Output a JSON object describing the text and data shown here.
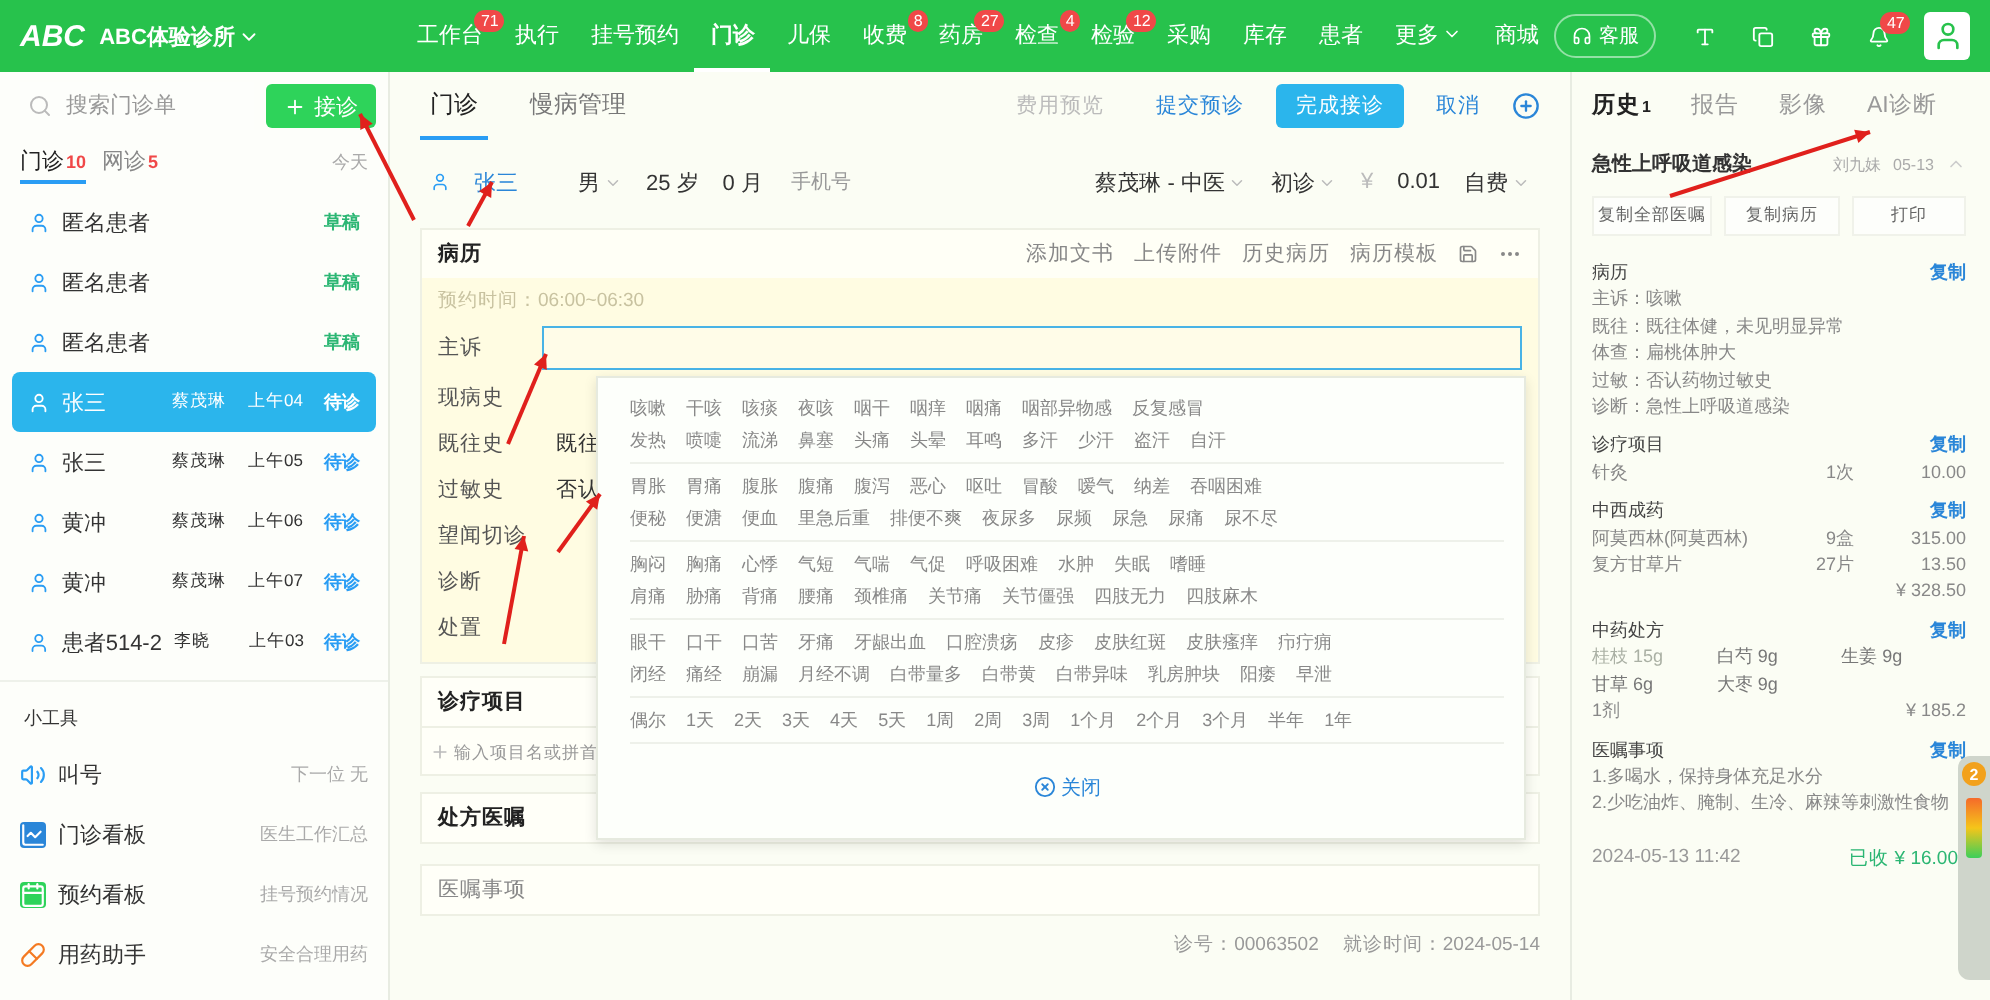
{
  "top_bar": {
    "logo": "ABC",
    "clinic": "ABC体验诊所",
    "nav": [
      {
        "label": "工作台",
        "badge": "71",
        "selected": false
      },
      {
        "label": "执行",
        "selected": false
      },
      {
        "label": "挂号预约",
        "selected": false
      },
      {
        "label": "门诊",
        "selected": true
      },
      {
        "label": "儿保",
        "selected": false
      },
      {
        "label": "收费",
        "badge": "8",
        "selected": false
      },
      {
        "label": "药房",
        "badge": "27",
        "selected": false
      },
      {
        "label": "检查",
        "badge": "4",
        "selected": false
      },
      {
        "label": "检验",
        "badge": "12",
        "selected": false
      },
      {
        "label": "采购",
        "selected": false
      },
      {
        "label": "库存",
        "selected": false
      },
      {
        "label": "患者",
        "selected": false
      },
      {
        "label": "更多",
        "selected": false,
        "caret": true
      },
      {
        "label": "商城",
        "selected": false
      }
    ],
    "service": "客服",
    "notification_badge": "47"
  },
  "left_panel": {
    "search": {
      "placeholder": "搜索门诊单"
    },
    "new_button": "接诊",
    "tabs": [
      {
        "label": "门诊",
        "count": "10",
        "selected": true
      },
      {
        "label": "网诊",
        "count": "5",
        "selected": false
      }
    ],
    "date_filter": "今天",
    "patients": [
      {
        "name": "匿名患者",
        "status": "草稿",
        "color": "#2bb673",
        "selected": false
      },
      {
        "name": "匿名患者",
        "status": "草稿",
        "color": "#2bb673",
        "selected": false
      },
      {
        "name": "匿名患者",
        "status": "草稿",
        "color": "#2bb673",
        "selected": false
      },
      {
        "name": "张三",
        "doctor": "蔡茂琳",
        "time": "上午04",
        "status": "待诊",
        "selected": true
      },
      {
        "name": "张三",
        "doctor": "蔡茂琳",
        "time": "上午05",
        "status": "待诊",
        "color": "#2a9df4",
        "selected": false
      },
      {
        "name": "黄冲",
        "doctor": "蔡茂琳",
        "time": "上午06",
        "status": "待诊",
        "color": "#2a9df4",
        "selected": false
      },
      {
        "name": "黄冲",
        "doctor": "蔡茂琳",
        "time": "上午07",
        "status": "待诊",
        "color": "#2a9df4",
        "selected": false
      },
      {
        "name": "患者514-2",
        "doctor": "李晓",
        "time": "上午03",
        "status": "待诊",
        "color": "#2a9df4",
        "selected": false
      }
    ],
    "tools_title": "小工具",
    "tools": [
      {
        "kind": "speaker",
        "label": "叫号",
        "hint": "下一位 无"
      },
      {
        "kind": "chart",
        "label": "门诊看板",
        "hint": "医生工作汇总"
      },
      {
        "kind": "calendar",
        "label": "预约看板",
        "hint": "挂号预约情况"
      },
      {
        "kind": "pill",
        "label": "用药助手",
        "hint": "安全合理用药"
      }
    ]
  },
  "main": {
    "tabs": [
      {
        "label": "门诊",
        "selected": true
      },
      {
        "label": "慢病管理",
        "selected": false
      }
    ],
    "actions": [
      {
        "label": "费用预览",
        "kind": "disabled"
      },
      {
        "label": "提交预诊",
        "kind": "link"
      },
      {
        "label": "完成接诊",
        "kind": "primary"
      },
      {
        "label": "取消",
        "kind": "link"
      }
    ],
    "patient": {
      "name": "张三",
      "sex": "男",
      "age_years": "25 岁",
      "age_months": "0 月",
      "phone": {
        "placeholder": "手机号"
      },
      "doctor": "蔡茂琳 - 中医",
      "visit_type": "初诊",
      "currency": "¥",
      "fee": "0.01",
      "payment": "自费"
    },
    "record": {
      "title": "病历",
      "tools": [
        "添加文书",
        "上传附件",
        "历史病历",
        "病历模板"
      ],
      "appointment": "预约时间：06:00~06:30",
      "fields": [
        {
          "label": "主诉",
          "focused": true
        },
        {
          "label": "现病史",
          "focused": false
        },
        {
          "label": "既往史",
          "value": "既往",
          "focused": false
        },
        {
          "label": "过敏史",
          "value": "否认",
          "focused": false
        },
        {
          "label": "望闻切诊",
          "focused": false
        },
        {
          "label": "诊断",
          "focused": false
        },
        {
          "label": "处置",
          "focused": false
        }
      ]
    },
    "suggestions": {
      "groups": [
        [
          [
            "咳嗽",
            "干咳",
            "咳痰",
            "夜咳",
            "咽干",
            "咽痒",
            "咽痛",
            "咽部异物感",
            "反复感冒"
          ],
          [
            "发热",
            "喷嚏",
            "流涕",
            "鼻塞",
            "头痛",
            "头晕",
            "耳鸣",
            "多汗",
            "少汗",
            "盗汗",
            "自汗"
          ]
        ],
        [
          [
            "胃胀",
            "胃痛",
            "腹胀",
            "腹痛",
            "腹泻",
            "恶心",
            "呕吐",
            "冒酸",
            "嗳气",
            "纳差",
            "吞咽困难"
          ],
          [
            "便秘",
            "便溏",
            "便血",
            "里急后重",
            "排便不爽",
            "夜尿多",
            "尿频",
            "尿急",
            "尿痛",
            "尿不尽"
          ]
        ],
        [
          [
            "胸闷",
            "胸痛",
            "心悸",
            "气短",
            "气喘",
            "气促",
            "呼吸困难",
            "水肿",
            "失眠",
            "嗜睡"
          ],
          [
            "肩痛",
            "胁痛",
            "背痛",
            "腰痛",
            "颈椎痛",
            "关节痛",
            "关节僵强",
            "四肢无力",
            "四肢麻木"
          ]
        ],
        [
          [
            "眼干",
            "口干",
            "口苦",
            "牙痛",
            "牙龈出血",
            "口腔溃疡",
            "皮疹",
            "皮肤红斑",
            "皮肤瘙痒",
            "疖疔痈"
          ],
          [
            "闭经",
            "痛经",
            "崩漏",
            "月经不调",
            "白带量多",
            "白带黄",
            "白带异味",
            "乳房肿块",
            "阳痿",
            "早泄"
          ]
        ],
        [
          [
            "偶尔",
            "1天",
            "2天",
            "3天",
            "4天",
            "5天",
            "1周",
            "2周",
            "3周",
            "1个月",
            "2个月",
            "3个月",
            "半年",
            "1年"
          ]
        ]
      ],
      "close": "关闭"
    },
    "treatment": {
      "title": "诊疗项目",
      "placeholder": "输入项目名或拼首"
    },
    "prescription": {
      "title": "处方医嘱"
    },
    "advice": {
      "label": "医嘱事项"
    },
    "footer": {
      "visit_no": "诊号：00063502",
      "visit_time": "就诊时间：2024-05-14"
    }
  },
  "right_panel": {
    "tabs": [
      {
        "label": "历史",
        "count": "1",
        "selected": true
      },
      {
        "label": "报告",
        "selected": false
      },
      {
        "label": "影像",
        "selected": false
      },
      {
        "label": "AI诊断",
        "selected": false
      }
    ],
    "card": {
      "title": "急性上呼吸道感染",
      "doctor": "刘九妹",
      "date": "05-13",
      "expanded": true,
      "buttons": [
        "复制全部医嘱",
        "复制病历",
        "打印"
      ],
      "sections": [
        {
          "kind": "lines",
          "title": "病历",
          "copy": "复制",
          "lines": [
            "主诉：咳嗽",
            "既往：既往体健，未见明显异常",
            "体查：扁桃体肿大",
            "过敏：否认药物过敏史",
            "诊断：急性上呼吸道感染"
          ]
        },
        {
          "kind": "items",
          "title": "诊疗项目",
          "copy": "复制",
          "items": [
            {
              "name": "针灸",
              "qty": "1次",
              "amount": "10.00"
            }
          ]
        },
        {
          "kind": "items",
          "title": "中西成药",
          "copy": "复制",
          "items": [
            {
              "name": "阿莫西林(阿莫西林)",
              "qty": "9盒",
              "amount": "315.00"
            },
            {
              "name": "复方甘草片",
              "qty": "27片",
              "amount": "13.50"
            }
          ],
          "total": "¥ 328.50"
        },
        {
          "kind": "herbs",
          "title": "中药处方",
          "copy": "复制",
          "herbs": [
            {
              "name": "桂枝 15g",
              "dimmed": true
            },
            {
              "name": "白芍 9g",
              "dimmed": false
            },
            {
              "name": "生姜 9g",
              "dimmed": false
            },
            {
              "name": "甘草 6g",
              "dimmed": false
            },
            {
              "name": "大枣 9g",
              "dimmed": false
            }
          ],
          "doses": "1剂",
          "total": "¥ 185.2"
        },
        {
          "kind": "lines",
          "title": "医嘱事项",
          "copy": "复制",
          "lines": [
            "1.多喝水，保持身体充足水分",
            "2.少吃油炸、腌制、生冷、麻辣等刺激性食物"
          ]
        }
      ],
      "time": "2024-05-13 11:42",
      "paid": "已收 ¥ 16.00"
    }
  },
  "float_widget": {
    "badge": "2"
  }
}
